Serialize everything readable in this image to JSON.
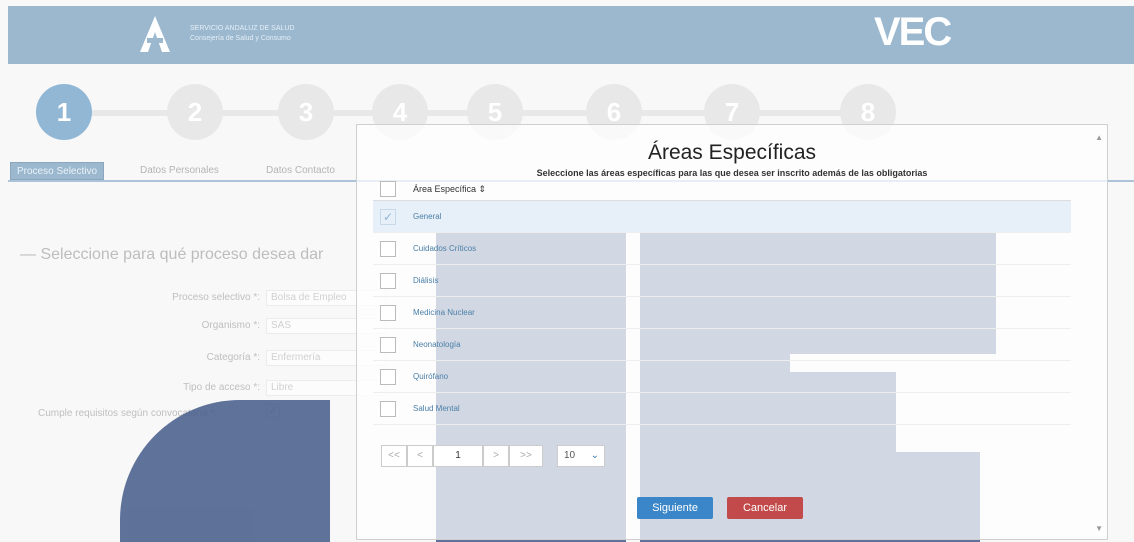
{
  "header": {
    "logo_line1": "SERVICIO ANDALUZ DE SALUD",
    "logo_line2": "Consejería de Salud y Consumo",
    "brand": "VEC"
  },
  "steps": [
    "1",
    "2",
    "3",
    "4",
    "5",
    "6",
    "7",
    "8"
  ],
  "active_step": "1",
  "tabs": [
    "Proceso Selectivo",
    "Datos Personales",
    "Datos Contacto"
  ],
  "background_form": {
    "section_title": "Seleccione para qué proceso desea dar",
    "fields": [
      {
        "label": "Proceso selectivo *:",
        "value": "Bolsa de Empleo"
      },
      {
        "label": "Organismo *:",
        "value": "SAS"
      },
      {
        "label": "Categoría *:",
        "value": "Enfermería"
      },
      {
        "label": "Tipo de acceso *:",
        "value": "Libre"
      }
    ],
    "requirements_label": "Cumple requisitos según convocatoria *:",
    "requirements_checked": "✓"
  },
  "modal": {
    "title": "Áreas Específicas",
    "subtitle": "Seleccione las áreas específicas para las que desea ser inscrito además de las obligatorias",
    "column_header": "Área Específica  ⇕",
    "rows": [
      {
        "label": "General",
        "checked": "✓"
      },
      {
        "label": "Cuidados Críticos",
        "checked": ""
      },
      {
        "label": "Diálisis",
        "checked": ""
      },
      {
        "label": "Medicina Nuclear",
        "checked": ""
      },
      {
        "label": "Neonatología",
        "checked": ""
      },
      {
        "label": "Quirófano",
        "checked": ""
      },
      {
        "label": "Salud Mental",
        "checked": ""
      }
    ],
    "pager": {
      "first": "<<",
      "prev": "<",
      "page": "1",
      "next": ">",
      "last": ">>",
      "page_size": "10",
      "chevron": "⌄"
    },
    "next_label": "Siguiente",
    "cancel_label": "Cancelar",
    "scroll_up": "▲",
    "scroll_down": "▼"
  },
  "colors": {
    "header_bg": "#4a7fa8",
    "active_step": "#3a7cb1",
    "primary_button": "#3a86c8",
    "cancel_button": "#c24a4a",
    "watermark": "#485e8c"
  }
}
